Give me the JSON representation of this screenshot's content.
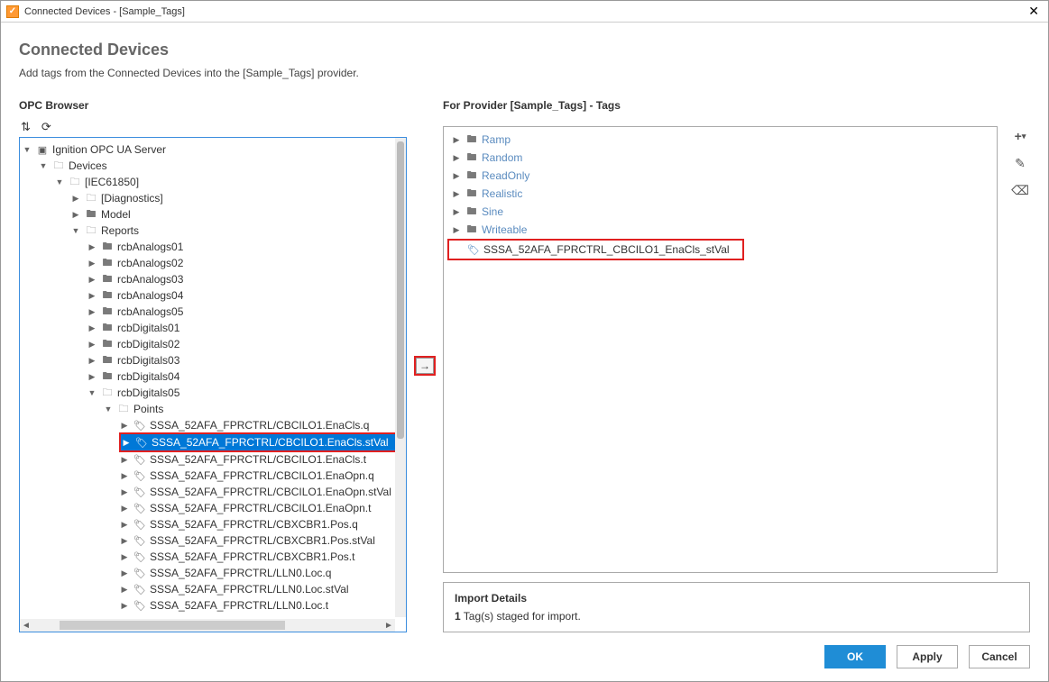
{
  "window": {
    "title": "Connected Devices - [Sample_Tags]",
    "close": "✕"
  },
  "header": {
    "title": "Connected Devices",
    "subtitle": "Add tags from the Connected Devices into the [Sample_Tags] provider."
  },
  "left": {
    "panel_label": "OPC Browser",
    "sort_icon": "⇅",
    "refresh_icon": "⟳"
  },
  "mid": {
    "arrow": "→"
  },
  "right": {
    "panel_label": "For Provider [Sample_Tags] - Tags",
    "tools": {
      "add": "+",
      "edit": "✎",
      "delete": "⌫"
    }
  },
  "import": {
    "title": "Import Details",
    "line_prefix": "1",
    "line_rest": " Tag(s) staged for import."
  },
  "footer": {
    "ok": "OK",
    "apply": "Apply",
    "cancel": "Cancel"
  },
  "opc_tree": {
    "root": "Ignition OPC UA Server",
    "devices": "Devices",
    "iec": "[IEC61850]",
    "diagnostics": "[Diagnostics]",
    "model": "Model",
    "reports": "Reports",
    "rcbAnalogs": [
      "rcbAnalogs01",
      "rcbAnalogs02",
      "rcbAnalogs03",
      "rcbAnalogs04",
      "rcbAnalogs05"
    ],
    "rcbDigitals_closed": [
      "rcbDigitals01",
      "rcbDigitals02",
      "rcbDigitals03",
      "rcbDigitals04"
    ],
    "rcbDigitals_open": "rcbDigitals05",
    "points": "Points",
    "point_items": [
      "SSSA_52AFA_FPRCTRL/CBCILO1.EnaCls.q",
      "SSSA_52AFA_FPRCTRL/CBCILO1.EnaCls.stVal",
      "SSSA_52AFA_FPRCTRL/CBCILO1.EnaCls.t",
      "SSSA_52AFA_FPRCTRL/CBCILO1.EnaOpn.q",
      "SSSA_52AFA_FPRCTRL/CBCILO1.EnaOpn.stVal",
      "SSSA_52AFA_FPRCTRL/CBCILO1.EnaOpn.t",
      "SSSA_52AFA_FPRCTRL/CBXCBR1.Pos.q",
      "SSSA_52AFA_FPRCTRL/CBXCBR1.Pos.stVal",
      "SSSA_52AFA_FPRCTRL/CBXCBR1.Pos.t",
      "SSSA_52AFA_FPRCTRL/LLN0.Loc.q",
      "SSSA_52AFA_FPRCTRL/LLN0.Loc.stVal",
      "SSSA_52AFA_FPRCTRL/LLN0.Loc.t"
    ],
    "selected_index": 1
  },
  "provider_tree": {
    "items": [
      {
        "label": "Ramp",
        "muted": true
      },
      {
        "label": "Random",
        "muted": true
      },
      {
        "label": "ReadOnly",
        "muted": true
      },
      {
        "label": "Realistic",
        "muted": true
      },
      {
        "label": "Sine",
        "muted": true
      },
      {
        "label": "Writeable",
        "muted": true
      }
    ],
    "staged_tag": "SSSA_52AFA_FPRCTRL_CBCILO1_EnaCls_stVal"
  }
}
